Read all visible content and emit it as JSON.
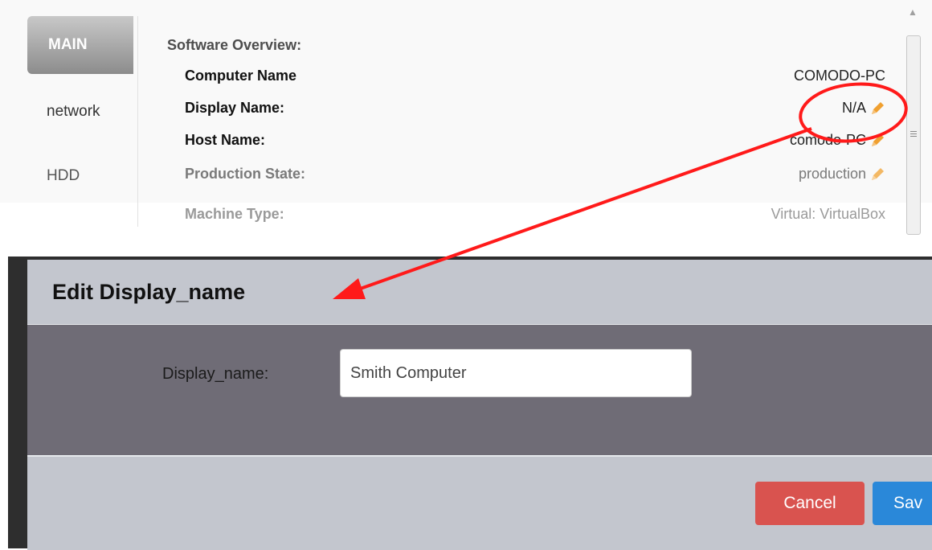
{
  "tabs": {
    "main": "MAIN",
    "network": "network",
    "hdd": "HDD"
  },
  "overview": {
    "title": "Software Overview:",
    "rows": [
      {
        "label": "Computer Name",
        "value": "COMODO-PC",
        "editable": false
      },
      {
        "label": "Display Name:",
        "value": "N/A",
        "editable": true
      },
      {
        "label": "Host Name:",
        "value": "comodo-PC",
        "editable": true
      },
      {
        "label": "Production State:",
        "value": "production",
        "editable": true
      },
      {
        "label": "Machine Type:",
        "value": "Virtual: VirtualBox",
        "editable": false
      }
    ]
  },
  "dialog": {
    "title": "Edit Display_name",
    "field_label": "Display_name:",
    "field_value": "Smith Computer",
    "cancel_label": "Cancel",
    "save_label": "Sav"
  },
  "colors": {
    "pencil": "#f0a030",
    "callout": "#ff1a1a",
    "cancel": "#d9534f",
    "save": "#2a88d9",
    "dialog_body": "#6f6c76",
    "dialog_header": "#c3c6ce"
  },
  "icons": {
    "edit": "pencil-icon",
    "scroll_up": "scroll-up-arrow-icon",
    "scroll_grip": "scroll-grip-icon"
  }
}
